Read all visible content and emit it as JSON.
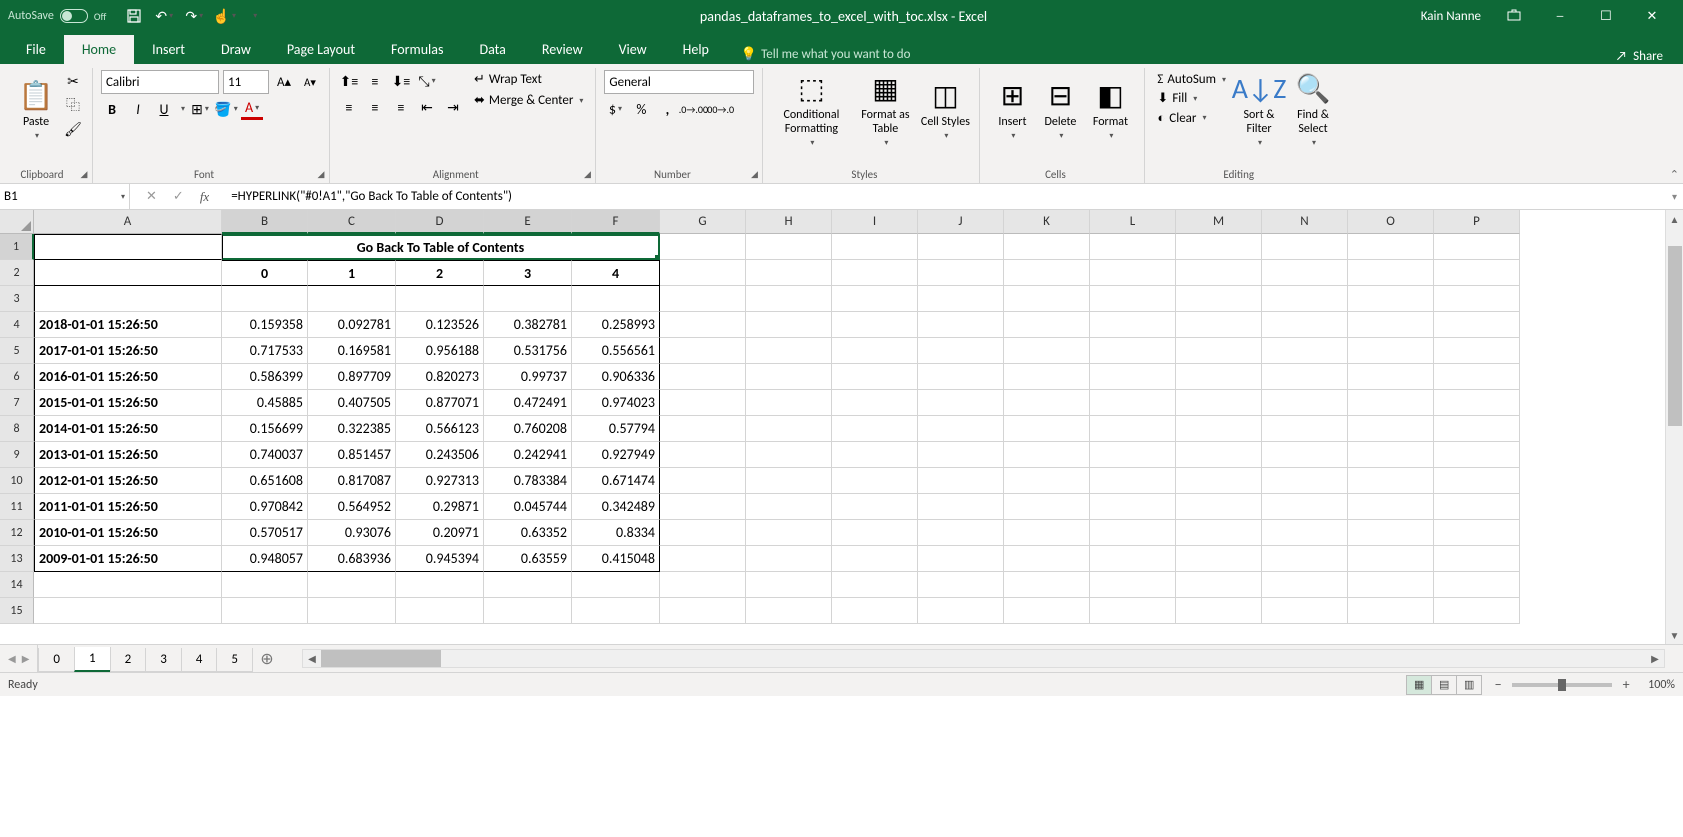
{
  "titlebar": {
    "autosave_label": "AutoSave",
    "autosave_status": "Off",
    "title": "pandas_dataframes_to_excel_with_toc.xlsx - Excel",
    "user": "Kain Nanne"
  },
  "tabs": [
    "File",
    "Home",
    "Insert",
    "Draw",
    "Page Layout",
    "Formulas",
    "Data",
    "Review",
    "View",
    "Help"
  ],
  "active_tab": "Home",
  "tell_me": "Tell me what you want to do",
  "share_label": "Share",
  "ribbon": {
    "clipboard": {
      "paste": "Paste",
      "label": "Clipboard"
    },
    "font": {
      "name": "Calibri",
      "size": "11",
      "label": "Font",
      "bold": "B",
      "italic": "I",
      "underline": "U"
    },
    "alignment": {
      "wrap": "Wrap Text",
      "merge": "Merge & Center",
      "label": "Alignment"
    },
    "number": {
      "format": "General",
      "label": "Number"
    },
    "styles": {
      "conditional": "Conditional Formatting",
      "formatas": "Format as Table",
      "cell": "Cell Styles",
      "label": "Styles"
    },
    "cells": {
      "insert": "Insert",
      "delete": "Delete",
      "format": "Format",
      "label": "Cells"
    },
    "editing": {
      "autosum": "AutoSum",
      "fill": "Fill",
      "clear": "Clear",
      "sort": "Sort & Filter",
      "find": "Find & Select",
      "label": "Editing"
    }
  },
  "formula_bar": {
    "cell_ref": "B1",
    "formula": "=HYPERLINK(\"#0!A1\",\"Go Back To Table of Contents\")"
  },
  "columns": [
    "A",
    "B",
    "C",
    "D",
    "E",
    "F",
    "G",
    "H",
    "I",
    "J",
    "K",
    "L",
    "M",
    "N",
    "O",
    "P"
  ],
  "sheet": {
    "hyperlink_text": "Go Back To Table of Contents",
    "col_headers": [
      "0",
      "1",
      "2",
      "3",
      "4"
    ],
    "rows": [
      {
        "label": "2018-01-01 15:26:50",
        "vals": [
          "0.159358",
          "0.092781",
          "0.123526",
          "0.382781",
          "0.258993"
        ]
      },
      {
        "label": "2017-01-01 15:26:50",
        "vals": [
          "0.717533",
          "0.169581",
          "0.956188",
          "0.531756",
          "0.556561"
        ]
      },
      {
        "label": "2016-01-01 15:26:50",
        "vals": [
          "0.586399",
          "0.897709",
          "0.820273",
          "0.99737",
          "0.906336"
        ]
      },
      {
        "label": "2015-01-01 15:26:50",
        "vals": [
          "0.45885",
          "0.407505",
          "0.877071",
          "0.472491",
          "0.974023"
        ]
      },
      {
        "label": "2014-01-01 15:26:50",
        "vals": [
          "0.156699",
          "0.322385",
          "0.566123",
          "0.760208",
          "0.57794"
        ]
      },
      {
        "label": "2013-01-01 15:26:50",
        "vals": [
          "0.740037",
          "0.851457",
          "0.243506",
          "0.242941",
          "0.927949"
        ]
      },
      {
        "label": "2012-01-01 15:26:50",
        "vals": [
          "0.651608",
          "0.817087",
          "0.927313",
          "0.783384",
          "0.671474"
        ]
      },
      {
        "label": "2011-01-01 15:26:50",
        "vals": [
          "0.970842",
          "0.564952",
          "0.29871",
          "0.045744",
          "0.342489"
        ]
      },
      {
        "label": "2010-01-01 15:26:50",
        "vals": [
          "0.570517",
          "0.93076",
          "0.20971",
          "0.63352",
          "0.8334"
        ]
      },
      {
        "label": "2009-01-01 15:26:50",
        "vals": [
          "0.948057",
          "0.683936",
          "0.945394",
          "0.63559",
          "0.415048"
        ]
      }
    ]
  },
  "sheet_tabs": [
    "0",
    "1",
    "2",
    "3",
    "4",
    "5"
  ],
  "active_sheet": "1",
  "status": {
    "ready": "Ready",
    "zoom": "100%"
  }
}
